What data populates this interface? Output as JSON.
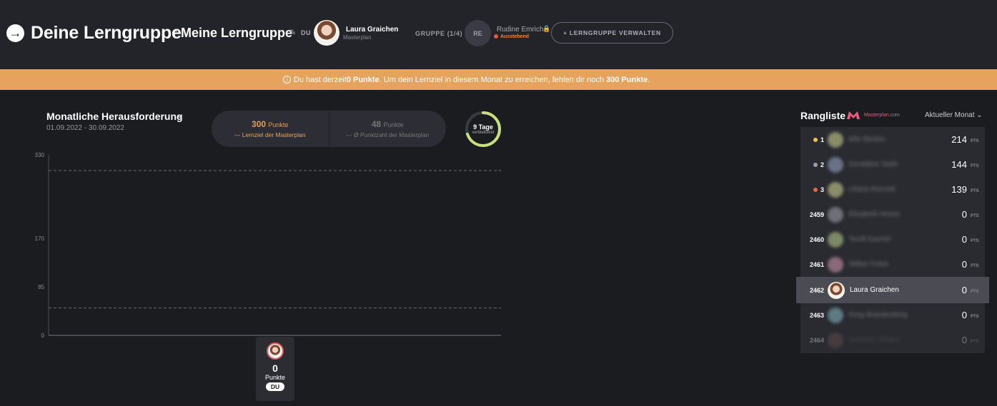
{
  "header": {
    "title": "Deine Lerngruppe",
    "separator": ":",
    "group_name": "Meine Lerngruppe",
    "du_label": "DU",
    "user_name": "Laura Graichen",
    "user_sub": "Masterplan",
    "group_count": "GRUPPE (1/4)",
    "pending_initials": "RE",
    "pending_name": "Rudine Emrich",
    "pending_status": "Ausstehend",
    "manage_label": "+ LERNGRUPPE VERWALTEN"
  },
  "banner": {
    "pre": "Du hast derzeit ",
    "points_current": "0 Punkte",
    "mid": ". Um dein Lernziel in diesem Monat zu erreichen, fehlen dir noch ",
    "points_missing": "300 Punkte",
    "post": "."
  },
  "challenge": {
    "title": "Monatliche Herausforderung",
    "dates": "01.09.2022 - 30.09.2022",
    "goal_value": "300",
    "goal_unit": "Punkte",
    "goal_label": "--- Lernziel der Masterplan",
    "avg_value": "48",
    "avg_unit": "Punkte",
    "avg_label": "--- Ø Punktzahl der Masterplan",
    "days_value": "9 Tage",
    "days_label": "verbleibend",
    "days_fraction": 0.7
  },
  "chart_data": {
    "type": "bar",
    "yticks": [
      0,
      85,
      170,
      330
    ],
    "ylim": [
      0,
      330
    ],
    "reference_lines": [
      {
        "name": "Lernziel der Masterplan",
        "value": 300
      },
      {
        "name": "Ø Punktzahl der Masterplan",
        "value": 48
      }
    ],
    "categories": [
      "DU"
    ],
    "values": [
      0
    ],
    "user_card": {
      "points": "0",
      "points_label": "Punkte",
      "tag": "DU"
    }
  },
  "ranking": {
    "title": "Rangliste",
    "brand": "Masterplan",
    "brand_domain": ".com",
    "month_select": "Aktueller Monat",
    "pts_label": "PTS",
    "rows": [
      {
        "pos": "1",
        "name": "Milo Becker",
        "points": "214",
        "medal": "#f2c14e",
        "avatar_color": "#8a8c6a"
      },
      {
        "pos": "2",
        "name": "Geraldine Stahl",
        "points": "144",
        "medal": "#9aa0aa",
        "avatar_color": "#6a7288"
      },
      {
        "pos": "3",
        "name": "Liliana Reinold",
        "points": "139",
        "medal": "#e2684a",
        "avatar_color": "#8a8c6a"
      },
      {
        "pos": "2459",
        "name": "Elisabeth Hesse",
        "points": "0",
        "medal": "",
        "avatar_color": "#6e6f78"
      },
      {
        "pos": "2460",
        "name": "Terrill Gaertel",
        "points": "0",
        "medal": "",
        "avatar_color": "#7e8866"
      },
      {
        "pos": "2461",
        "name": "Wilber Feleit",
        "points": "0",
        "medal": "",
        "avatar_color": "#8a6a78"
      },
      {
        "pos": "2462",
        "name": "Laura Graichen",
        "points": "0",
        "medal": "",
        "avatar_color": "#c9a080"
      },
      {
        "pos": "2463",
        "name": "Greg Brandenberg",
        "points": "0",
        "medal": "",
        "avatar_color": "#5e7a82"
      },
      {
        "pos": "2464",
        "name": "Hendrich Strand",
        "points": "0",
        "medal": "",
        "avatar_color": "#7a5a5a"
      }
    ]
  }
}
